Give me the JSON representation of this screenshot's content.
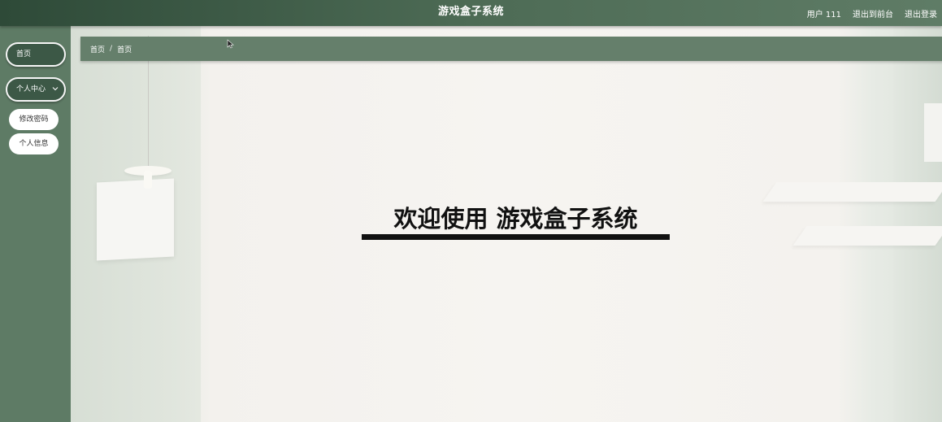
{
  "header": {
    "title": "游戏盒子系统",
    "links": {
      "user": "用户 111",
      "frontend": "退出到前台",
      "logout": "退出登录"
    }
  },
  "sidebar": {
    "home": "首页",
    "personal_center": "个人中心",
    "sub_items": [
      "修改密码",
      "个人信息"
    ]
  },
  "breadcrumb": [
    "首页",
    "首页"
  ],
  "main": {
    "welcome": "欢迎使用 游戏盒子系统"
  },
  "colors": {
    "header_bg": "#3d5a46",
    "sidebar_bg": "#5e7b65",
    "pill_bg": "#3c5846",
    "breadcrumb_bg": "#657f6b"
  }
}
